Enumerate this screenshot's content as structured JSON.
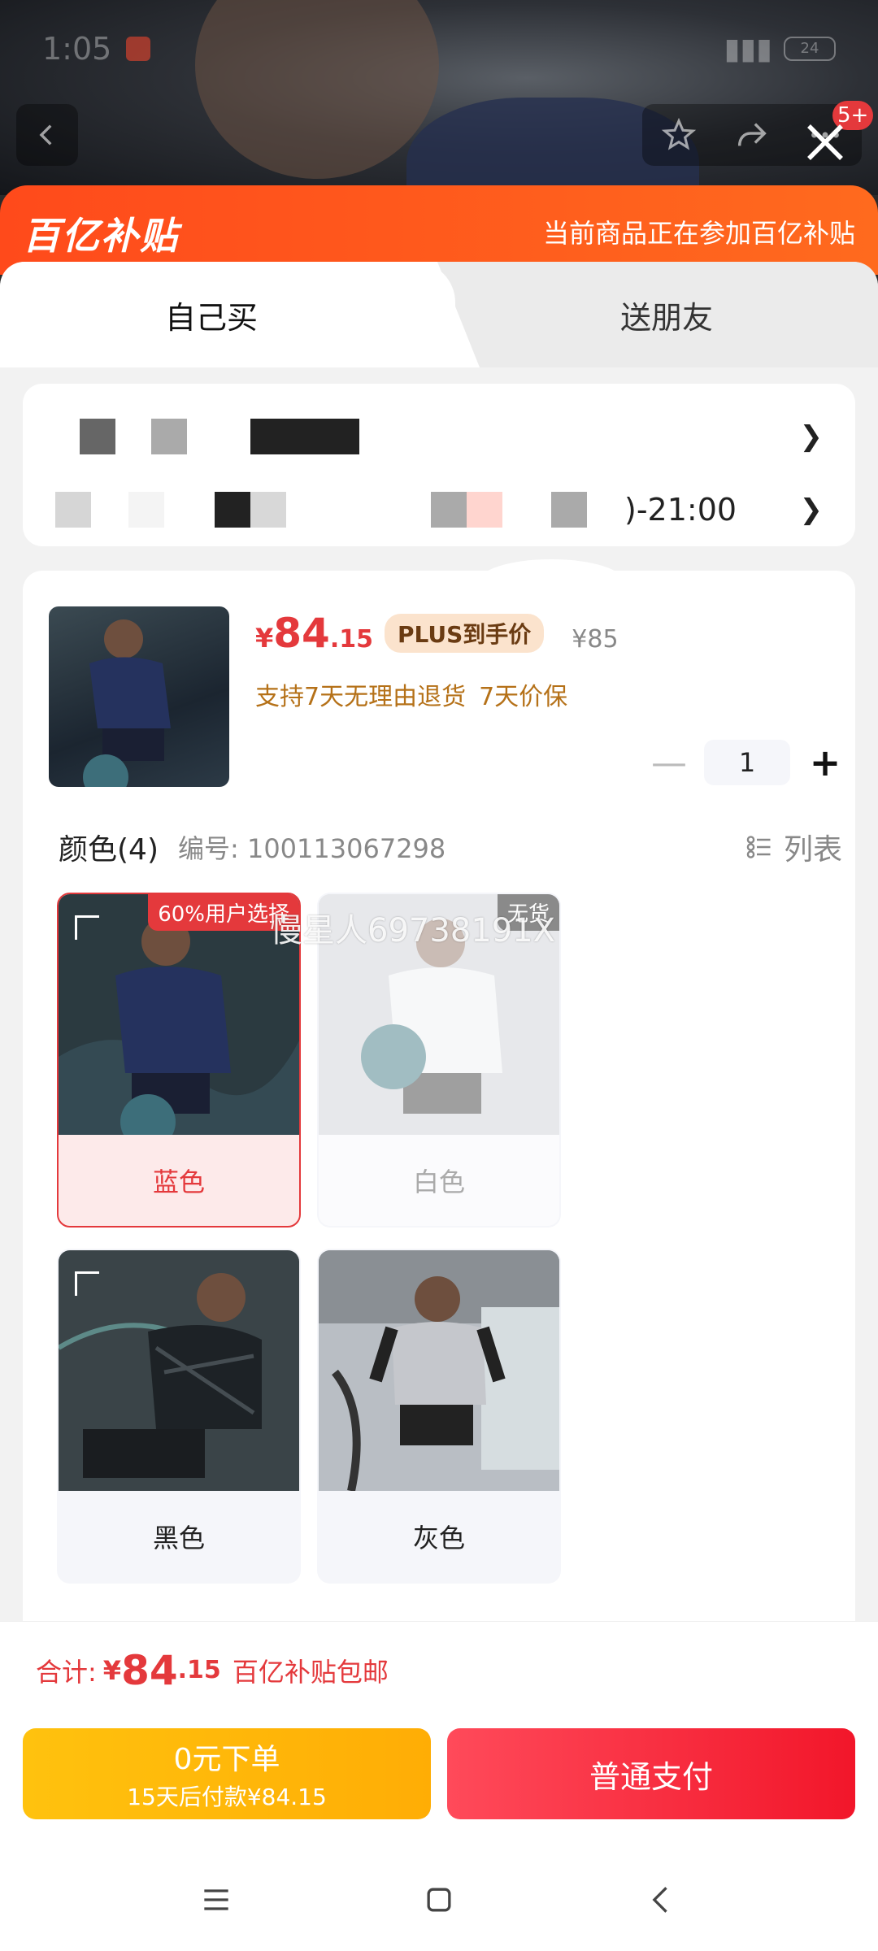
{
  "status_bar": {
    "time": "1:05",
    "battery": "24"
  },
  "header": {
    "cart_badge": "5+"
  },
  "banner": {
    "logo": "百亿补贴",
    "text": "当前商品正在参加百亿补贴"
  },
  "tabs": [
    {
      "label": "自己买"
    },
    {
      "label": "送朋友"
    }
  ],
  "address": {
    "time_suffix": ")-21:00"
  },
  "product": {
    "price_symbol": "¥",
    "price_int": "84",
    "price_dec": ".15",
    "plus_tag": "PLUS到手价",
    "original_price": "¥85",
    "promise_1": "支持7天无理由退货",
    "promise_2": "7天价保",
    "quantity": "1"
  },
  "color_section": {
    "title": "颜色(4)",
    "sku": "编号: 100113067298",
    "list_label": "列表"
  },
  "variants": [
    {
      "label": "蓝色",
      "tag": "60%用户选择",
      "state": "selected"
    },
    {
      "label": "白色",
      "tag": "无货",
      "state": "disabled"
    },
    {
      "label": "黑色",
      "tag": "",
      "state": "normal"
    },
    {
      "label": "灰色",
      "tag": "",
      "state": "normal"
    }
  ],
  "watermark": "慢星人69738191X",
  "total": {
    "label": "合计:",
    "symbol": "¥",
    "int": "84",
    "dec": ".15",
    "note": "百亿补贴包邮"
  },
  "actions": {
    "later_line1": "0元下单",
    "later_line2": "15天后付款¥84.15",
    "pay": "普通支付"
  },
  "colors": {
    "accent": "#e4393c",
    "banner": "#ff5a1d",
    "later": "#ffb80a"
  }
}
